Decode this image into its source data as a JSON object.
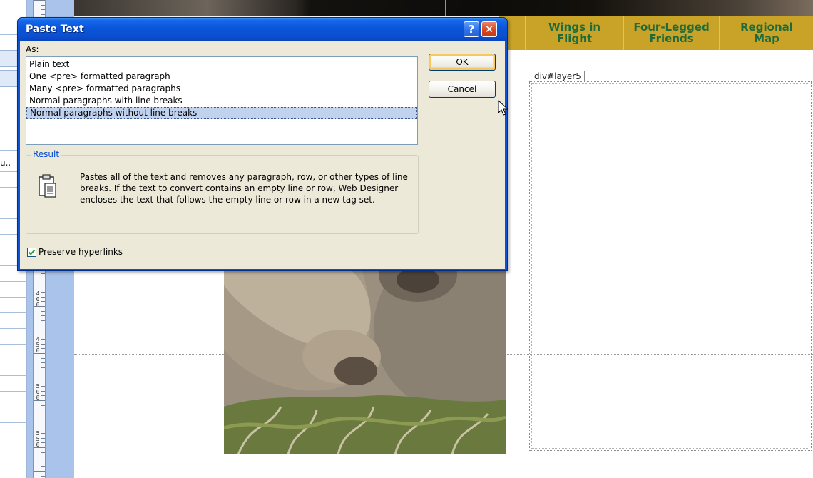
{
  "dialog": {
    "title": "Paste Text",
    "help_label": "?",
    "close_label": "✕",
    "as_label": "As:",
    "options": [
      "Plain text",
      "One <pre> formatted paragraph",
      "Many <pre> formatted paragraphs",
      "Normal paragraphs with line breaks",
      "Normal paragraphs without line breaks"
    ],
    "selected_index": 4,
    "ok_label": "OK",
    "cancel_label": "Cancel",
    "result_label": "Result",
    "result_text": "Pastes all of the text and removes any paragraph, row, or other types of line breaks. If the text to convert contains an empty line or row, Web Designer encloses the text that follows the empty line or row in a new tag set.",
    "preserve_hyperlinks_label": "Preserve hyperlinks",
    "preserve_hyperlinks_checked": true
  },
  "nav": {
    "items": [
      "Wings in\nFlight",
      "Four-Legged\nFriends",
      "Regional\nMap"
    ],
    "bg_color": "#c9a327",
    "text_color": "#1f6b3a"
  },
  "layer_tag": "div#layer5",
  "left_panel": {
    "truncated_text": "u.."
  },
  "ruler": {
    "labels": [
      "4\n0\n0",
      "4\n5\n0",
      "5\n0\n0",
      "5\n5\n0"
    ]
  }
}
